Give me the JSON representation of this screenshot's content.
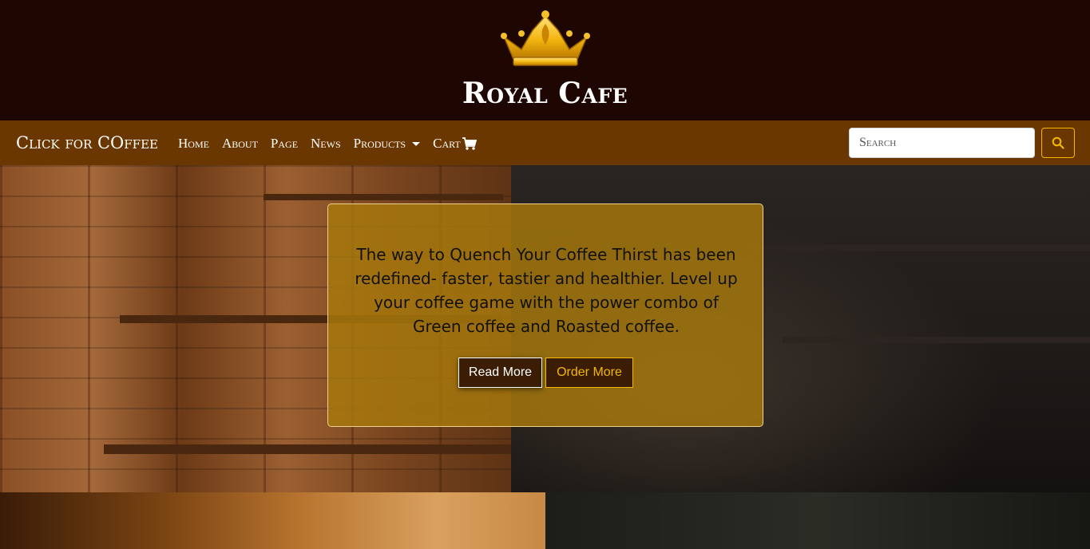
{
  "brand": {
    "title": "Royal Cafe",
    "logo_icon": "crown-icon"
  },
  "navbar": {
    "brand": "Click for COffee",
    "links": [
      "Home",
      "About",
      "Page",
      "News",
      "Products",
      "Cart"
    ],
    "cart_icon": "shopping-cart-icon",
    "search": {
      "placeholder": "Search",
      "button_icon": "search-icon"
    }
  },
  "hero": {
    "text": "The way to Quench Your Coffee Thirst has been redefined- faster, tastier and healthier. Level up your coffee game with the power combo of Green coffee and Roasted coffee.",
    "read_more": "Read More",
    "order_more": "Order More"
  },
  "colors": {
    "top_bar": "#1e0702",
    "navbar": "#6b3700",
    "accent": "#f5b800",
    "card": "#a87a0c"
  }
}
